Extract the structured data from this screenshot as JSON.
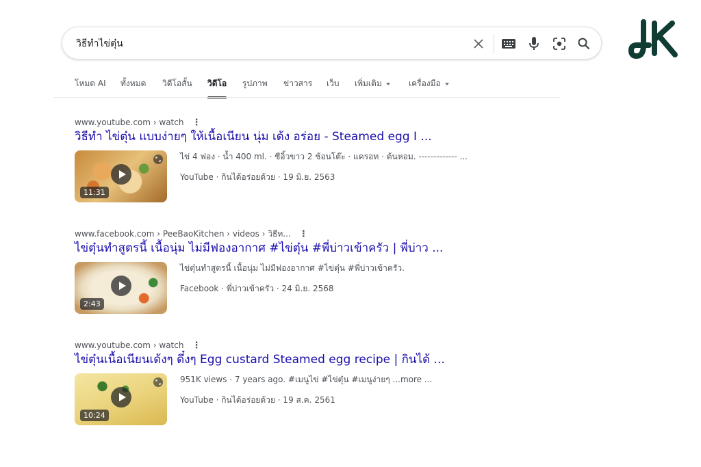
{
  "search": {
    "query": "วิธีทำไข่ตุ๋น",
    "clear_label": "×"
  },
  "tabs": [
    {
      "label": "โหมด AI"
    },
    {
      "label": "ทั้งหมด"
    },
    {
      "label": "วิดีโอสั้น"
    },
    {
      "label": "วิดีโอ",
      "active": true
    },
    {
      "label": "รูปภาพ"
    },
    {
      "label": "ข่าวสาร"
    },
    {
      "label": "เว็บ"
    },
    {
      "label": "เพิ่มเติม"
    },
    {
      "label": "เครื่องมือ"
    }
  ],
  "results": [
    {
      "breadcrumb": "www.youtube.com › watch",
      "title": "วิธีทำ ไข่ตุ๋น แบบง่ายๆ ให้เนื้อเนียน นุ่ม เด้ง อร่อย - Steamed egg I ...",
      "duration": "11:31",
      "snippet": "ไข่ 4 ฟอง · น้ำ 400 ml. · ซีอิ้วขาว 2 ช้อนโต๊ะ · แครอท · ต้นหอม. ------------- ...",
      "meta": "YouTube · กินได้อร่อยด้วย · 19 มิ.ย. 2563"
    },
    {
      "breadcrumb": "www.facebook.com › PeeBaoKitchen › videos › วิธีท...",
      "title": "ไข่ตุ๋นทำสูตรนี้ เนื้อนุ่ม ไม่มีฟองอากาศ #ไข่ตุ๋น #พี่บ่าวเข้าครัว | พี่บ่าว ...",
      "duration": "2:43",
      "snippet": "ไข่ตุ๋นทำสูตรนี้ เนื้อนุ่ม ไม่มีฟองอากาศ #ไข่ตุ๋น #พี่บ่าวเข้าครัว.",
      "meta": "Facebook · พี่บ่าวเข้าครัว · 24 มิ.ย. 2568"
    },
    {
      "breadcrumb": "www.youtube.com › watch",
      "title": "ไข่ตุ๋นเนื้อเนียนเด้งๆ ดึ๋งๆ Egg custard Steamed egg recipe | กินได้ ...",
      "duration": "10:24",
      "snippet": "951K views · 7 years ago. #เมนูไข่ #ไข่ตุ๋น #เมนูง่ายๆ ...more ...",
      "meta": "YouTube · กินได้อร่อยด้วย · 19 ส.ค. 2561"
    }
  ],
  "colors": {
    "link": "#1a0dab",
    "text_secondary": "#4d5156",
    "logo": "#0f3d33"
  },
  "icons": [
    "close-icon",
    "keyboard-icon",
    "mic-icon",
    "lens-icon",
    "search-icon",
    "play-icon",
    "kebab-menu-icon",
    "logo"
  ]
}
